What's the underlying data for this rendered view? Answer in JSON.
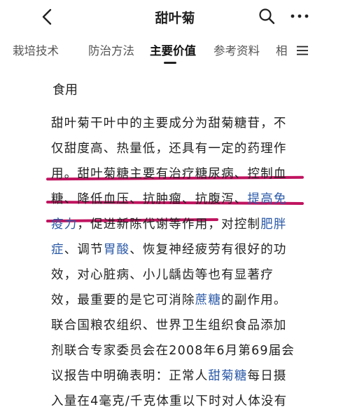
{
  "header": {
    "back_icon": "chevron-left-icon",
    "title": "甜叶菊",
    "search_icon": "search-icon",
    "more_icon": "more-dots-icon"
  },
  "tabs": {
    "items": [
      {
        "label": "栽培技术"
      },
      {
        "label": "防治方法"
      },
      {
        "label": "主要价值"
      },
      {
        "label": "参考资料"
      },
      {
        "label": "相"
      }
    ],
    "active": "主要价值",
    "menu_icon": "menu-icon"
  },
  "section": {
    "heading": "食用",
    "lines": [
      [
        "甜叶菊干叶中的主要成分为甜菊糖苷，不"
      ],
      [
        "仅甜度高、热量低，还具有一定的药理作"
      ],
      [
        "用。甜叶菊糖主要有治疗糖尿病、控制血"
      ],
      [
        "糖、降低血压、抗肿瘤、抗腹泻、",
        {
          "link": "提高免"
        }
      ],
      [
        {
          "link": "疫力"
        },
        "，促进新陈代谢等作用，对控制",
        {
          "link": "肥胖"
        }
      ],
      [
        {
          "link": "症"
        },
        "、调节",
        {
          "link": "胃酸"
        },
        "、恢复神经疲劳有很好的功"
      ],
      [
        "效，对心脏病、小儿龋齿等也有显著疗"
      ],
      [
        "效，最重要的是它可消除",
        {
          "link": "蔗糖"
        },
        "的副作用。"
      ],
      [
        "联合国粮农组织、世界卫生组织食品添加"
      ],
      [
        "剂联合专家委员会在2008年6月第69届会"
      ],
      [
        "议报告中明确表明：正常人",
        {
          "link": "甜菊糖"
        },
        "每日摄"
      ],
      [
        "入量在4毫克/千克体重以下时对人体没有"
      ]
    ]
  },
  "colors": {
    "link": "#2b5aa8",
    "highlight_underline": "#c0135f",
    "text": "#222222"
  }
}
